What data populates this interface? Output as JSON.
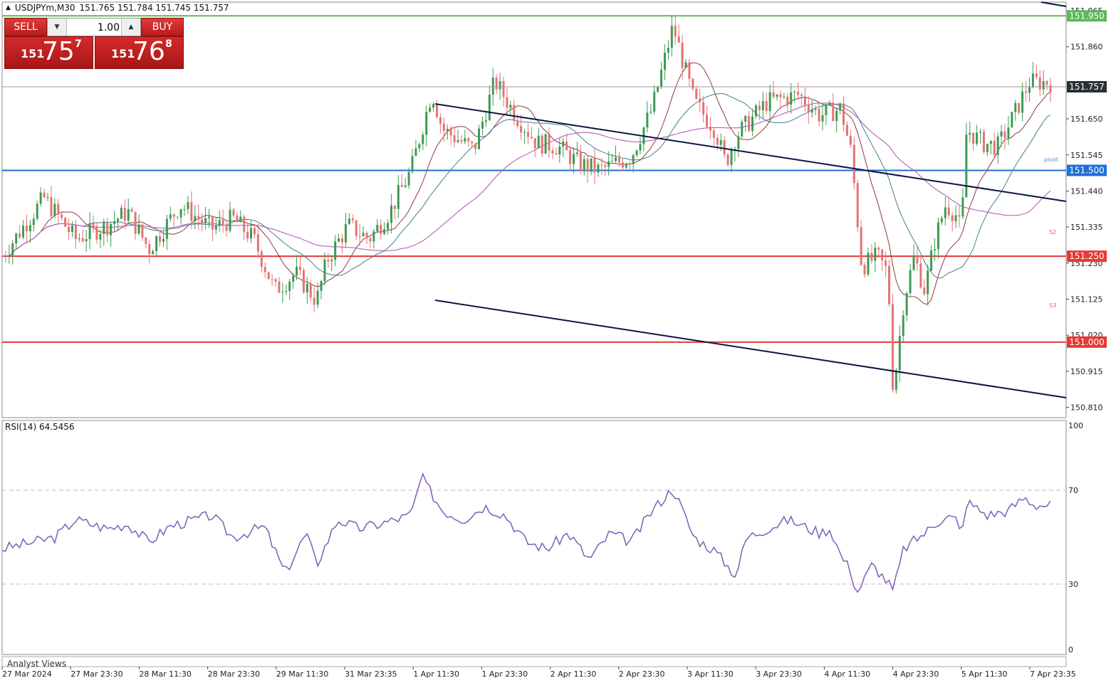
{
  "header": {
    "symbol": "USDJPYm,M30",
    "ohlc": "151.765 151.784 151.745 151.757"
  },
  "trade_panel": {
    "sell_label": "SELL",
    "buy_label": "BUY",
    "lot_value": "1.00",
    "sell_price": {
      "big": "151",
      "huge": "75",
      "sup": "7"
    },
    "buy_price": {
      "big": "151",
      "huge": "76",
      "sup": "8"
    },
    "colors": {
      "button": "#c62828"
    }
  },
  "price_axis": {
    "ticks": [
      "151.965",
      "151.860",
      "151.650",
      "151.545",
      "151.440",
      "151.335",
      "151.230",
      "151.125",
      "151.020",
      "150.915",
      "150.810"
    ],
    "current_price": "151.757"
  },
  "levels": [
    {
      "price": 151.95,
      "label": "151.950",
      "color": "#5cb85c"
    },
    {
      "price": 151.5,
      "label": "151.500",
      "color": "#1e6fd9"
    },
    {
      "price": 151.25,
      "label": "151.250",
      "color": "#e53935"
    },
    {
      "price": 151.0,
      "label": "151.000",
      "color": "#e53935"
    }
  ],
  "pivot_tags": [
    "pivot",
    "S2",
    "S3"
  ],
  "time_axis": [
    "27 Mar 2024",
    "27 Mar 23:30",
    "28 Mar 11:30",
    "28 Mar 23:30",
    "29 Mar 11:30",
    "31 Mar 23:35",
    "1 Apr 11:30",
    "1 Apr 23:30",
    "2 Apr 11:30",
    "2 Apr 23:30",
    "3 Apr 11:30",
    "3 Apr 23:30",
    "4 Apr 11:30",
    "4 Apr 23:30",
    "5 Apr 11:30",
    "7 Apr 23:35"
  ],
  "rsi": {
    "label": "RSI(14) 64.5456",
    "levels": [
      "100",
      "70",
      "30",
      "0"
    ],
    "color": "#7b5fb5"
  },
  "footer": {
    "analyst_label": "Analyst Views"
  },
  "chart_data": {
    "type": "candlestick",
    "ylim": [
      150.78,
      151.99
    ],
    "close_path": [
      [
        0,
        151.25
      ],
      [
        0.04,
        151.42
      ],
      [
        0.07,
        151.3
      ],
      [
        0.1,
        151.34
      ],
      [
        0.12,
        151.38
      ],
      [
        0.14,
        151.27
      ],
      [
        0.17,
        151.4
      ],
      [
        0.2,
        151.33
      ],
      [
        0.22,
        151.36
      ],
      [
        0.24,
        151.3
      ],
      [
        0.26,
        151.15
      ],
      [
        0.28,
        151.2
      ],
      [
        0.3,
        151.12
      ],
      [
        0.31,
        151.24
      ],
      [
        0.33,
        151.34
      ],
      [
        0.35,
        151.3
      ],
      [
        0.37,
        151.38
      ],
      [
        0.39,
        151.5
      ],
      [
        0.41,
        151.73
      ],
      [
        0.42,
        151.62
      ],
      [
        0.45,
        151.56
      ],
      [
        0.47,
        151.76
      ],
      [
        0.49,
        151.66
      ],
      [
        0.51,
        151.58
      ],
      [
        0.53,
        151.57
      ],
      [
        0.55,
        151.52
      ],
      [
        0.57,
        151.5
      ],
      [
        0.6,
        151.54
      ],
      [
        0.62,
        151.68
      ],
      [
        0.64,
        151.92
      ],
      [
        0.66,
        151.7
      ],
      [
        0.67,
        151.66
      ],
      [
        0.68,
        151.62
      ],
      [
        0.69,
        151.52
      ],
      [
        0.7,
        151.6
      ],
      [
        0.73,
        151.7
      ],
      [
        0.76,
        151.72
      ],
      [
        0.78,
        151.66
      ],
      [
        0.8,
        151.68
      ],
      [
        0.81,
        151.55
      ],
      [
        0.82,
        151.22
      ],
      [
        0.835,
        151.25
      ],
      [
        0.845,
        151.2
      ],
      [
        0.85,
        150.85
      ],
      [
        0.86,
        151.12
      ],
      [
        0.87,
        151.25
      ],
      [
        0.88,
        151.15
      ],
      [
        0.89,
        151.3
      ],
      [
        0.9,
        151.4
      ],
      [
        0.91,
        151.37
      ],
      [
        0.915,
        151.32
      ],
      [
        0.92,
        151.62
      ],
      [
        0.935,
        151.58
      ],
      [
        0.95,
        151.57
      ],
      [
        0.965,
        151.66
      ],
      [
        0.98,
        151.757
      ]
    ],
    "rsi_path": [
      [
        0,
        45
      ],
      [
        0.05,
        50
      ],
      [
        0.07,
        58
      ],
      [
        0.1,
        54
      ],
      [
        0.12,
        56
      ],
      [
        0.14,
        48
      ],
      [
        0.16,
        55
      ],
      [
        0.2,
        60
      ],
      [
        0.22,
        50
      ],
      [
        0.25,
        55
      ],
      [
        0.27,
        34
      ],
      [
        0.29,
        52
      ],
      [
        0.3,
        38
      ],
      [
        0.32,
        58
      ],
      [
        0.34,
        54
      ],
      [
        0.36,
        56
      ],
      [
        0.39,
        60
      ],
      [
        0.4,
        77
      ],
      [
        0.42,
        62
      ],
      [
        0.44,
        58
      ],
      [
        0.46,
        64
      ],
      [
        0.48,
        60
      ],
      [
        0.5,
        48
      ],
      [
        0.52,
        45
      ],
      [
        0.54,
        52
      ],
      [
        0.56,
        40
      ],
      [
        0.58,
        52
      ],
      [
        0.6,
        48
      ],
      [
        0.62,
        62
      ],
      [
        0.64,
        72
      ],
      [
        0.66,
        50
      ],
      [
        0.68,
        44
      ],
      [
        0.7,
        33
      ],
      [
        0.71,
        50
      ],
      [
        0.73,
        54
      ],
      [
        0.75,
        58
      ],
      [
        0.77,
        54
      ],
      [
        0.78,
        52
      ],
      [
        0.79,
        54
      ],
      [
        0.8,
        42
      ],
      [
        0.81,
        35
      ],
      [
        0.815,
        25
      ],
      [
        0.83,
        38
      ],
      [
        0.845,
        30
      ],
      [
        0.85,
        26
      ],
      [
        0.86,
        45
      ],
      [
        0.88,
        52
      ],
      [
        0.9,
        60
      ],
      [
        0.91,
        58
      ],
      [
        0.915,
        50
      ],
      [
        0.92,
        66
      ],
      [
        0.94,
        60
      ],
      [
        0.96,
        62
      ],
      [
        0.975,
        68
      ],
      [
        0.985,
        64.5
      ]
    ]
  }
}
